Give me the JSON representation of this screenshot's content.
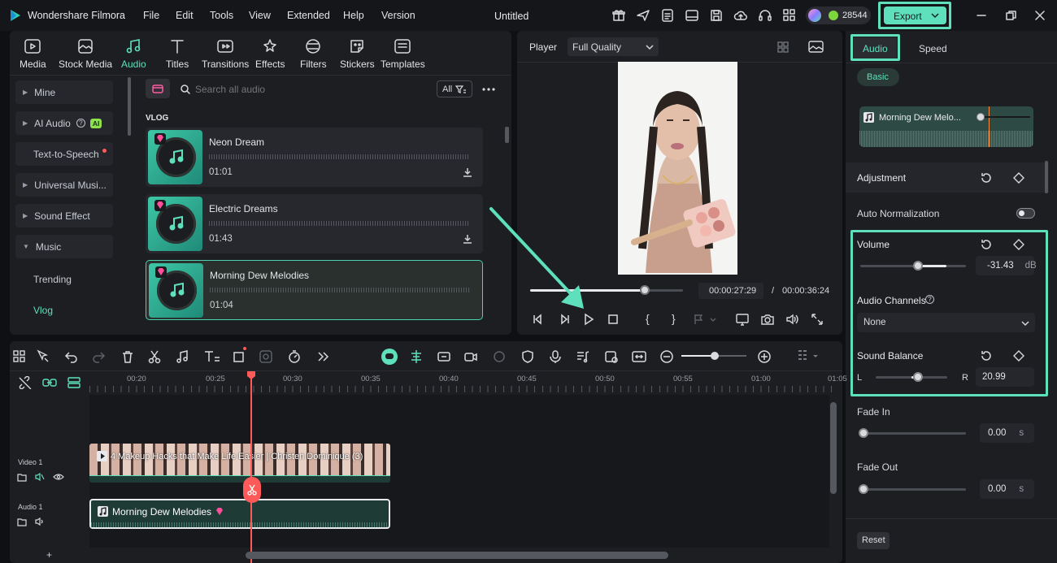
{
  "app": {
    "name": "Wondershare Filmora",
    "doc_title": "Untitled",
    "credits": "28544",
    "export_label": "Export"
  },
  "menu": [
    "File",
    "Edit",
    "Tools",
    "View",
    "Extended",
    "Help",
    "Version"
  ],
  "categories": [
    {
      "label": "Media",
      "icon": "media-icon"
    },
    {
      "label": "Stock Media",
      "icon": "stock-media-icon"
    },
    {
      "label": "Audio",
      "icon": "audio-icon"
    },
    {
      "label": "Titles",
      "icon": "titles-icon"
    },
    {
      "label": "Transitions",
      "icon": "transitions-icon"
    },
    {
      "label": "Effects",
      "icon": "effects-icon"
    },
    {
      "label": "Filters",
      "icon": "filters-icon"
    },
    {
      "label": "Stickers",
      "icon": "stickers-icon"
    },
    {
      "label": "Templates",
      "icon": "templates-icon"
    }
  ],
  "sidebar": {
    "mine": "Mine",
    "ai_audio": "AI Audio",
    "ai_badge": "AI",
    "tts": "Text-to-Speech",
    "universal": "Universal Musi...",
    "sound_effect": "Sound Effect",
    "music": "Music",
    "trending": "Trending",
    "vlog": "Vlog"
  },
  "search": {
    "placeholder": "Search all audio",
    "filter_label": "All"
  },
  "section_title": "VLOG",
  "tracks": [
    {
      "title": "Neon Dream",
      "duration": "01:01"
    },
    {
      "title": "Electric Dreams",
      "duration": "01:43"
    },
    {
      "title": "Morning Dew Melodies",
      "duration": "01:04"
    }
  ],
  "player": {
    "label": "Player",
    "quality": "Full Quality",
    "current_time": "00:00:27:29",
    "separator": "/",
    "total_time": "00:00:36:24",
    "progress": 0.75
  },
  "right": {
    "tab_audio": "Audio",
    "tab_speed": "Speed",
    "basic": "Basic",
    "clip_name": "Morning Dew Melo...",
    "adjustment": "Adjustment",
    "auto_normalization": "Auto Normalization",
    "volume": "Volume",
    "volume_value": "-31.43",
    "volume_unit": "dB",
    "audio_channels": "Audio Channels",
    "channels_value": "None",
    "sound_balance": "Sound Balance",
    "left": "L",
    "right": "R",
    "balance_value": "20.99",
    "fade_in": "Fade In",
    "fade_in_value": "0.00",
    "fade_out": "Fade Out",
    "fade_out_value": "0.00",
    "sec": "s",
    "reset": "Reset"
  },
  "timeline": {
    "ticks": [
      "00:20",
      "00:25",
      "00:30",
      "00:35",
      "00:40",
      "00:45",
      "00:50",
      "00:55",
      "01:00",
      "01:05"
    ],
    "video_track": "Video 1",
    "audio_track": "Audio 1",
    "video_clip": "4 Makeup Hacks that Make Life Easier | Christen Dominique (3)",
    "audio_clip": "Morning Dew Melodies"
  },
  "colors": {
    "accent": "#5fe0bc",
    "playhead": "#ff5a5a",
    "panel": "#1c1e22"
  }
}
